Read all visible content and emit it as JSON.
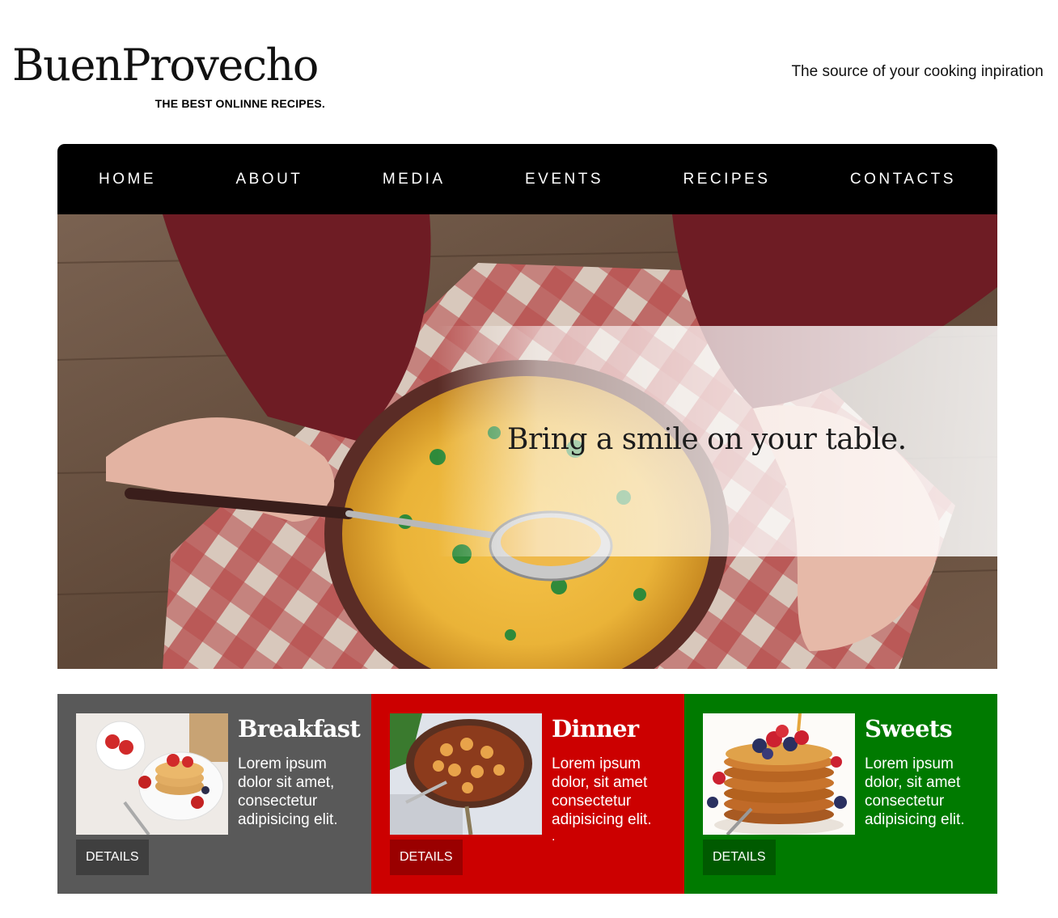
{
  "header": {
    "brand_name": "BuenProvecho",
    "brand_tagline": "THE BEST ONLINNE RECIPES.",
    "tagline": "The source of your cooking inpiration"
  },
  "nav": {
    "items": [
      "HOME",
      "ABOUT",
      "MEDIA",
      "EVENTS",
      "RECIPES",
      "CONTACTS"
    ]
  },
  "hero": {
    "headline": "Bring a smile on your table."
  },
  "cards": [
    {
      "title": "Breakfast",
      "text": "Lorem ipsum dolor sit amet, consectetur adipisicing elit.",
      "button": "DETAILS",
      "color": "#595959",
      "button_color": "#3f3f3f"
    },
    {
      "title": "Dinner",
      "text": "Lorem ipsum dolor, sit amet consectetur adipisicing elit.",
      "extra": ".",
      "button": "DETAILS",
      "color": "#cc0000",
      "button_color": "#9a0000"
    },
    {
      "title": "Sweets",
      "text": "Lorem ipsum dolor, sit amet consectetur adipisicing elit.",
      "button": "DETAILS",
      "color": "#007a00",
      "button_color": "#005a00"
    }
  ]
}
